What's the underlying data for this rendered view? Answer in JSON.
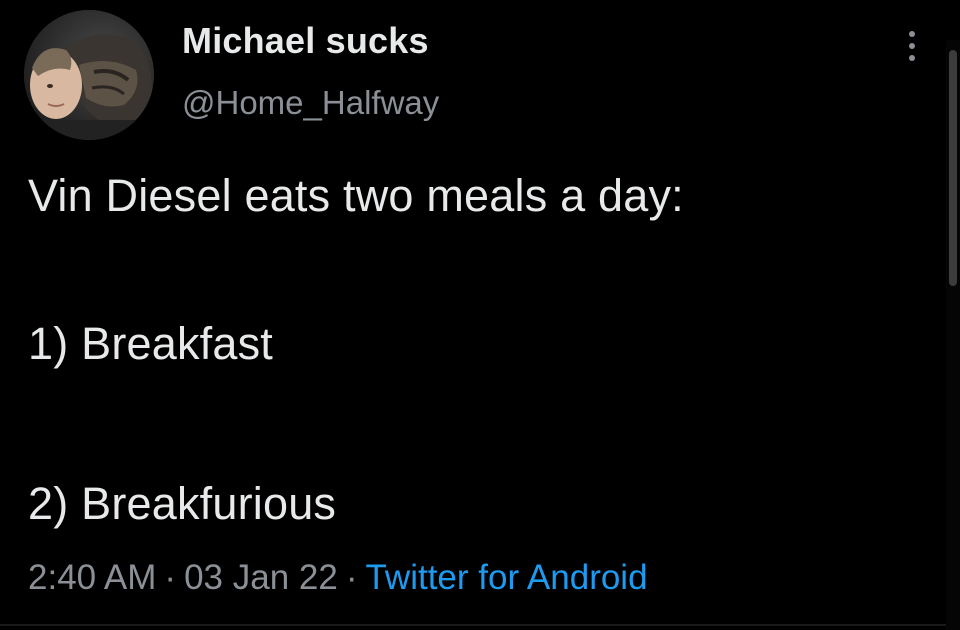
{
  "user": {
    "display_name": "Michael sucks",
    "handle": "@Home_Halfway",
    "avatar_icon": "profile-photo"
  },
  "tweet": {
    "lines": [
      "Vin Diesel eats two meals a day:",
      "1) Breakfast",
      "2) Breakfurious"
    ]
  },
  "meta": {
    "time": "2:40 AM",
    "separator": "·",
    "date": "03 Jan 22",
    "source": "Twitter for Android"
  },
  "icons": {
    "more": "more-vertical-icon"
  },
  "colors": {
    "background": "#000000",
    "primary_text": "#e7e9ea",
    "secondary_text": "#8b9096",
    "link": "#1d9bf0"
  }
}
